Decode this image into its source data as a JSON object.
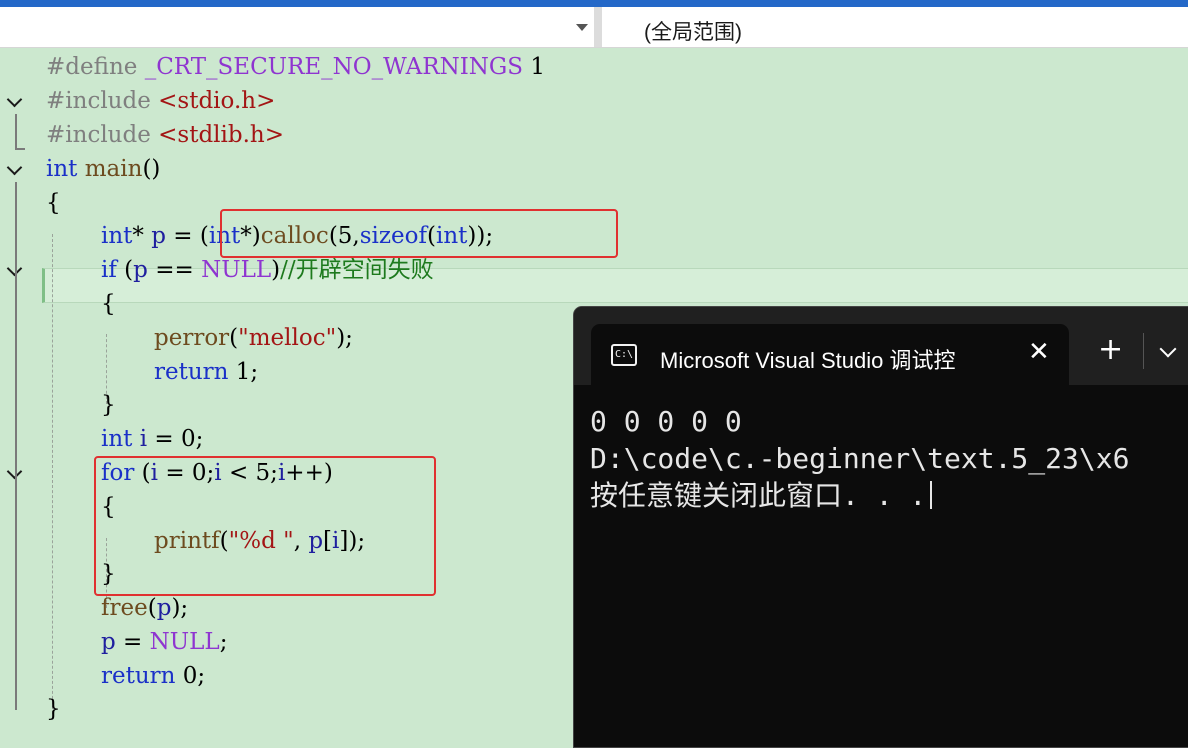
{
  "navbar": {
    "scope_label": "(全局范围)"
  },
  "code": {
    "l1": {
      "a": "#define ",
      "b": "_CRT_SECURE_NO_WARNINGS",
      "c": " 1"
    },
    "l2": {
      "a": "#include ",
      "b": "<stdio.h>"
    },
    "l3": {
      "a": "#include ",
      "b": "<stdlib.h>"
    },
    "l4": {
      "a": "int",
      "b": " main",
      "c": "()"
    },
    "l5": {
      "a": "{"
    },
    "l6": {
      "a": "int",
      "b": "* ",
      "c": "p",
      "d": " = ",
      "e": "(",
      "f": "int",
      "g": "*)",
      "h": "calloc",
      "i": "(5,",
      "j": "sizeof",
      "k": "(",
      "l": "int",
      "m": "));"
    },
    "l7": {
      "a": "if",
      "b": " (",
      "c": "p",
      "d": " == ",
      "e": "NULL",
      "f": ")",
      "g": "//开辟空间失败"
    },
    "l8": {
      "a": "{"
    },
    "l9": {
      "a": "perror",
      "b": "(",
      "c": "\"melloc\"",
      "d": ");"
    },
    "l10": {
      "a": "return",
      "b": " 1;"
    },
    "l11": {
      "a": "}"
    },
    "l12": {
      "a": "int",
      "b": " ",
      "c": "i",
      "d": " = 0;"
    },
    "l13": {
      "a": "for",
      "b": " (",
      "c": "i",
      "d": " = 0;",
      "e": "i",
      "f": " < 5;",
      "g": "i",
      "h": "++)"
    },
    "l14": {
      "a": "{"
    },
    "l15": {
      "a": "printf",
      "b": "(",
      "c": "\"%d \"",
      "d": ", ",
      "e": "p",
      "f": "[",
      "g": "i",
      "h": "]);"
    },
    "l16": {
      "a": "}"
    },
    "l17": {
      "a": "free",
      "b": "(",
      "c": "p",
      "d": ");"
    },
    "l18": {
      "a": "p",
      "b": " = ",
      "c": "NULL",
      "d": ";"
    },
    "l19": {
      "a": "return",
      "b": " 0;"
    },
    "l20": {
      "a": "}"
    }
  },
  "console": {
    "icon_text": "C:\\",
    "title": "Microsoft Visual Studio 调试控",
    "close_glyph": "✕",
    "new_tab_glyph": "+",
    "output": [
      "0 0 0 0 0",
      "D:\\code\\c.-beginner\\text.5_23\\x6",
      "按任意键关闭此窗口. . ."
    ]
  },
  "colors": {
    "editor_bg": "#cce8cf",
    "keyword": "#1a30c8",
    "string": "#a31515",
    "macro": "#8f35d0",
    "comment": "#1d7a1d",
    "highlight_box": "#e03030",
    "console_bg": "#0c0c0c"
  }
}
